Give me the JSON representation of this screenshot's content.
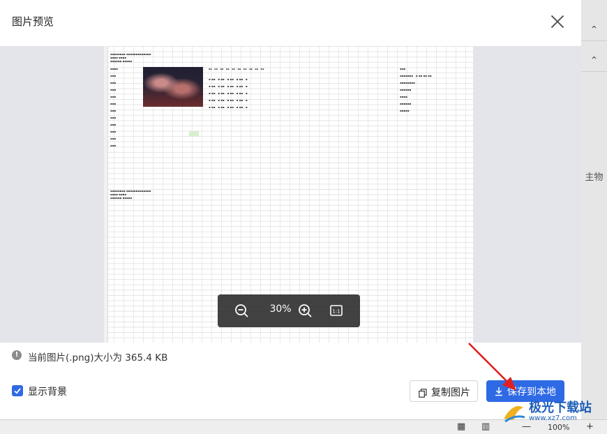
{
  "dialog": {
    "title": "图片预览",
    "zoom": {
      "level": "30%"
    },
    "info": {
      "size_text": "当前图片(.png)大小为 365.4 KB"
    },
    "show_background": {
      "label": "显示背景",
      "checked": true
    },
    "buttons": {
      "copy_label": "复制图片",
      "save_label": "保存到本地"
    }
  },
  "background_app": {
    "right_text": "主物",
    "zoom_text": "100%",
    "minus": "—",
    "plus": "+"
  },
  "watermark": {
    "text": "极光下载站",
    "url": "www.xz7.com"
  },
  "colors": {
    "primary": "#2f6ae5",
    "arrow": "#e02020",
    "zoom_bar": "#282828"
  }
}
